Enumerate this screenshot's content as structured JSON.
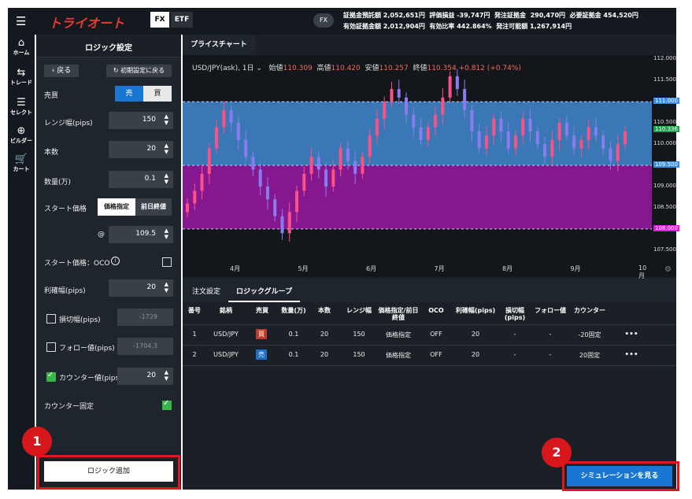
{
  "header": {
    "logo": "トライオート",
    "tabs": [
      "FX",
      "ETF"
    ],
    "mode_badge": "FX",
    "stats": [
      {
        "label": "証拠金預託額",
        "value": "2,052,651円"
      },
      {
        "label": "評価損益",
        "value": "-39,747円"
      },
      {
        "label": "発注証拠金",
        "value": "290,470円"
      },
      {
        "label": "必要証拠金",
        "value": "454,520円"
      },
      {
        "label": "有効証拠金額",
        "value": "2,012,904円"
      },
      {
        "label": "有効比率",
        "value": "442.864%"
      },
      {
        "label": "発注可能額",
        "value": "1,267,914円"
      }
    ]
  },
  "nav": [
    {
      "label": "ホーム",
      "icon": "home-icon"
    },
    {
      "label": "トレード",
      "icon": "trade-icon"
    },
    {
      "label": "セレクト",
      "icon": "select-icon"
    },
    {
      "label": "ビルダー",
      "icon": "builder-icon"
    },
    {
      "label": "カート",
      "icon": "cart-icon"
    }
  ],
  "panel": {
    "title": "ロジック設定",
    "back": "戻る",
    "reset": "初期設定に戻る",
    "side_label": "売買",
    "side_sell": "売",
    "side_buy": "買",
    "range_label": "レンジ幅(pips)",
    "range_value": "150",
    "count_label": "本数",
    "count_value": "20",
    "qty_label": "数量(万)",
    "qty_value": "0.1",
    "start_label": "スタート価格",
    "start_opt1": "価格指定",
    "start_opt2": "前日終値",
    "at": "@",
    "start_value": "109.5",
    "oco_label": "スタート価格：OCO",
    "profit_label": "利確幅(pips)",
    "profit_value": "20",
    "stop_label": "損切幅(pips)",
    "stop_value": "-1729",
    "follow_label": "フォロー値(pips)",
    "follow_value": "-1704.3",
    "counter_label": "カウンター値(pips)",
    "counter_value": "20",
    "counter_fixed_label": "カウンター固定",
    "add_logic": "ロジック追加"
  },
  "chart": {
    "tab": "プライスチャート",
    "symbol": "USD/JPY(ask), 1日",
    "open_label": "始値",
    "open": "110.309",
    "high_label": "高値",
    "high": "110.420",
    "low_label": "安値",
    "low": "110.257",
    "close_label": "終値",
    "close": "110.354",
    "change": "+0.812 (+0.74%)",
    "y_ticks": [
      "112.000",
      "111.500",
      "111.000",
      "110.500",
      "110.336",
      "110.000",
      "109.500",
      "109.000",
      "108.500",
      "108.000",
      "107.500"
    ],
    "x_ticks": [
      "4月",
      "5月",
      "6月",
      "7月",
      "8月",
      "9月",
      "10月"
    ]
  },
  "chart_data": {
    "type": "candlestick",
    "ylim": [
      107.2,
      112.1
    ],
    "blue_band": [
      109.5,
      111.0
    ],
    "purple_band": [
      108.0,
      109.5
    ],
    "current_price": 110.336,
    "close_series": [
      108.6,
      108.9,
      109.3,
      109.9,
      110.4,
      110.8,
      110.5,
      110.1,
      109.7,
      109.4,
      109.0,
      108.7,
      108.3,
      107.9,
      108.4,
      108.9,
      109.3,
      109.7,
      109.4,
      109.0,
      109.4,
      109.9,
      109.6,
      109.3,
      109.7,
      110.2,
      110.6,
      111.0,
      111.3,
      111.1,
      110.7,
      110.4,
      110.1,
      110.4,
      110.7,
      111.1,
      111.6,
      111.3,
      110.8,
      110.3,
      109.9,
      110.2,
      110.6,
      110.3,
      109.9,
      110.2,
      110.6,
      110.3,
      110.0,
      109.7,
      110.1,
      110.5,
      110.2,
      109.9,
      110.1,
      110.4,
      110.2,
      109.9,
      109.6,
      110.0,
      110.3
    ]
  },
  "tabs2": [
    "注文設定",
    "ロジックグループ"
  ],
  "table": {
    "headers": [
      "番号",
      "銘柄",
      "売買",
      "数量(万)",
      "本数",
      "レンジ幅",
      "価格指定/前日終値",
      "OCO",
      "利確幅(pips)",
      "損切幅(pips)",
      "フォロー値",
      "カウンター",
      ""
    ],
    "rows": [
      [
        "1",
        "USD/JPY",
        "買",
        "0.1",
        "20",
        "150",
        "価格指定",
        "OFF",
        "20",
        "-",
        "-",
        "-20固定",
        "•••"
      ],
      [
        "2",
        "USD/JPY",
        "売",
        "0.1",
        "20",
        "150",
        "価格指定",
        "OFF",
        "20",
        "-",
        "-",
        "20固定",
        "•••"
      ]
    ]
  },
  "simulate": "シミュレーションを見る",
  "callouts": [
    "1",
    "2"
  ],
  "colors": {
    "accent": "#1976d2",
    "callout": "#d8171c",
    "buy": "#c0392b",
    "sell": "#1a6fc4"
  }
}
